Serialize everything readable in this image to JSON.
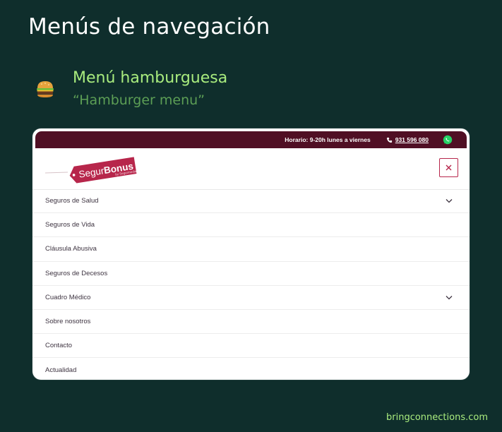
{
  "page": {
    "title": "Menús de navegación",
    "section_title": "Menú hamburguesa",
    "section_subtitle": "“Hamburger menu”",
    "footer": "bringconnections.com",
    "emoji_icon": "hamburger-emoji"
  },
  "mockup": {
    "topbar": {
      "hours": "Horario: 9-20h lunes a viernes",
      "phone": "931 596 080",
      "bg_color": "#500f24"
    },
    "logo": {
      "text": "SegurBonus",
      "byline": "by Segurmedia"
    },
    "menu": [
      {
        "label": "Seguros de Salud",
        "has_submenu": true
      },
      {
        "label": "Seguros de Vida",
        "has_submenu": false
      },
      {
        "label": "Cláusula Abusiva",
        "has_submenu": false
      },
      {
        "label": "Seguros de Decesos",
        "has_submenu": false
      },
      {
        "label": "Cuadro Médico",
        "has_submenu": true
      },
      {
        "label": "Sobre nosotros",
        "has_submenu": false
      },
      {
        "label": "Contacto",
        "has_submenu": false
      },
      {
        "label": "Actualidad",
        "has_submenu": false
      }
    ]
  },
  "colors": {
    "background": "#0f2e2c",
    "accent_green": "#a9ec7e",
    "brand_red": "#b7264b"
  }
}
